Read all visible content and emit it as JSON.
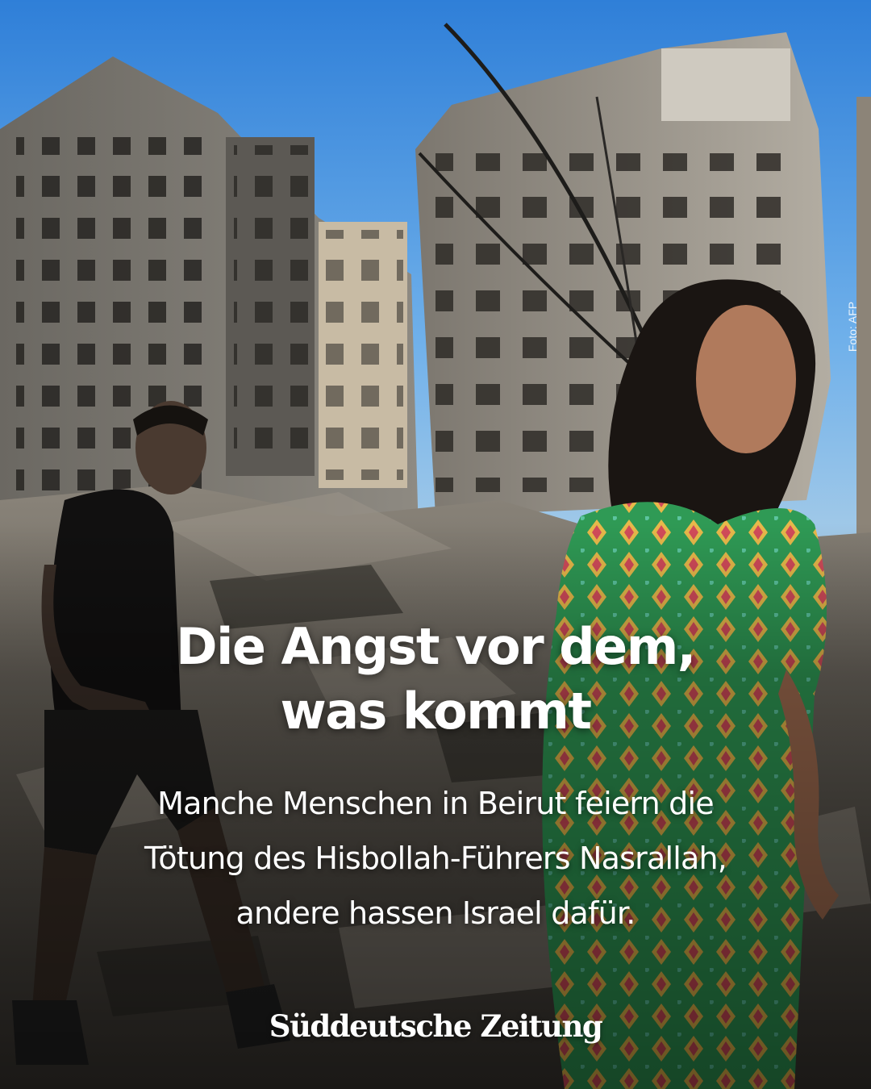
{
  "post": {
    "headline_lines": [
      "Die Angst vor dem,",
      "was kommt"
    ],
    "subtitle_lines": [
      "Manche Menschen in Beirut feiern die",
      "Tötung des Hisbollah-Führers Nasrallah,",
      "andere hassen Israel dafür."
    ],
    "logo_text": "Süddeutsche Zeitung",
    "photo_credit": "Foto: AFP"
  },
  "colors": {
    "sky": "#3f8fe0",
    "rubble": "#6e6860",
    "text": "#ffffff",
    "dress_green": "#3fa35a"
  }
}
